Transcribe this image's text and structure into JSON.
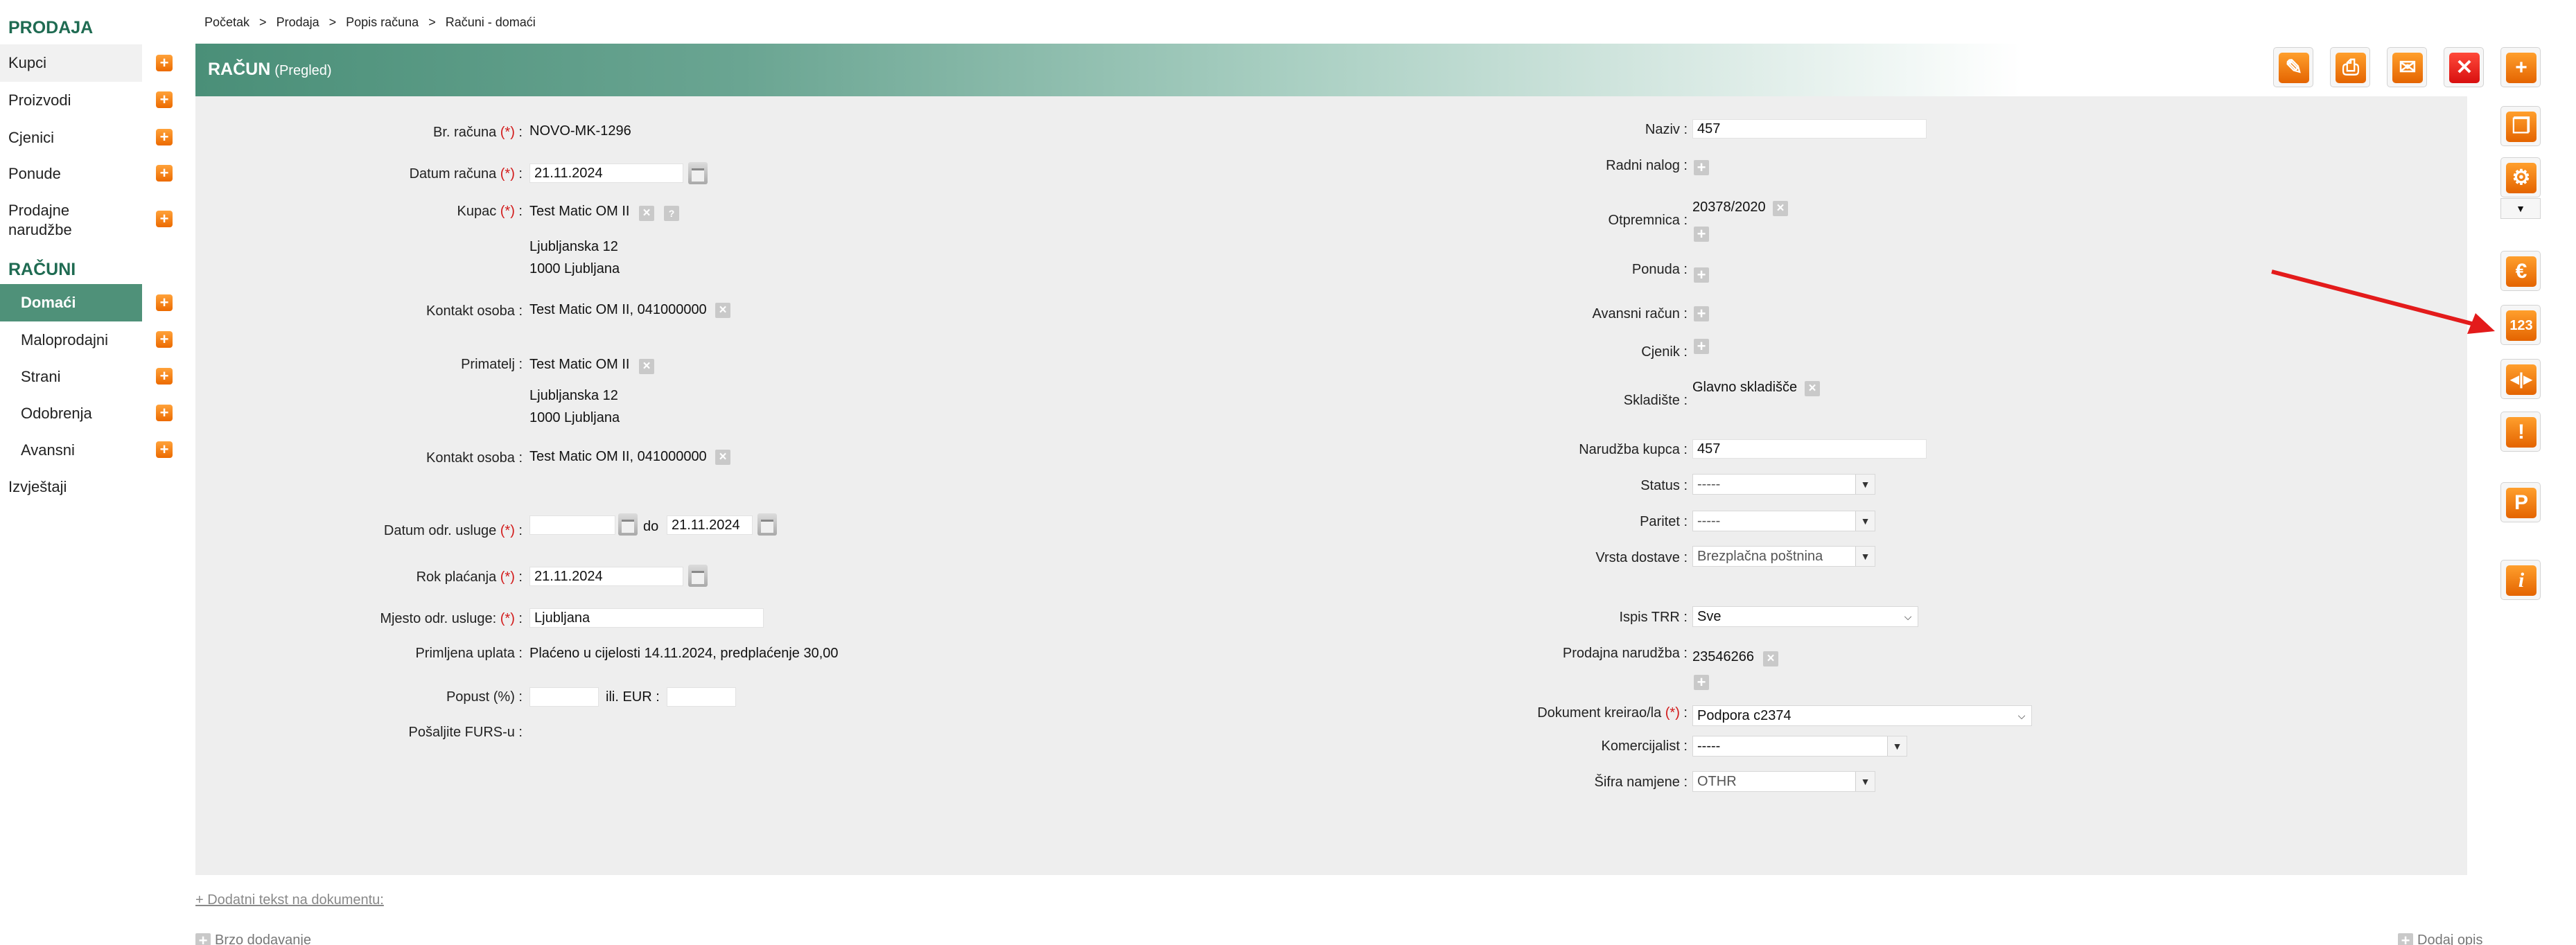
{
  "sidebar": {
    "prodaja_title": "PRODAJA",
    "prodaja_items": [
      {
        "label": "Kupci"
      },
      {
        "label": "Proizvodi"
      },
      {
        "label": "Cjenici"
      },
      {
        "label": "Ponude"
      },
      {
        "label": "Prodajne narudžbe"
      }
    ],
    "racuni_title": "RAČUNI",
    "racuni_items": [
      {
        "label": "Domaći"
      },
      {
        "label": "Maloprodajni"
      },
      {
        "label": "Strani"
      },
      {
        "label": "Odobrenja"
      },
      {
        "label": "Avansni"
      }
    ],
    "izvjestaji": "Izvještaji"
  },
  "breadcrumb": [
    "Početak",
    ">",
    "Prodaja",
    ">",
    "Popis računa",
    ">",
    "Računi - domaći"
  ],
  "header": {
    "title": "RAČUN",
    "subtitle": "(Pregled)"
  },
  "left": {
    "br_racuna_label": "Br. računa",
    "br_racuna": "NOVO-MK-1296",
    "datum_label": "Datum računa",
    "datum": "21.11.2024",
    "kupac_label": "Kupac",
    "kupac": "Test Matic OM II",
    "kupac_addr1": "Ljubljanska 12",
    "kupac_addr2": "1000 Ljubljana",
    "kontakt_label": "Kontakt osoba :",
    "kontakt": "Test Matic OM II, 041000000",
    "primatelj_label": "Primatelj :",
    "primatelj": "Test Matic OM II",
    "primatelj_addr1": "Ljubljanska 12",
    "primatelj_addr2": "1000 Ljubljana",
    "kontakt2_label": "Kontakt osoba :",
    "kontakt2": "Test Matic OM II, 041000000",
    "datum_usluge_label": "Datum odr. usluge",
    "datum_usluge_from": "",
    "do": "do",
    "datum_usluge_to": "21.11.2024",
    "rok_label": "Rok plaćanja",
    "rok": "21.11.2024",
    "mjesto_label": "Mjesto odr. usluge:",
    "mjesto": "Ljubljana",
    "uplata_label": "Primljena uplata :",
    "uplata": "Plaćeno u cijelosti 14.11.2024, predplaćenje 30,00",
    "popust_label": "Popust (%) :",
    "popust": "",
    "ili_eur": "ili. EUR :",
    "eur": "",
    "furs_label": "Pošaljite FURS-u :"
  },
  "right": {
    "naziv_label": "Naziv :",
    "naziv": "457",
    "radni_nalog_label": "Radni nalog :",
    "otpremnica_label": "Otpremnica :",
    "otpremnica": "20378/2020",
    "ponuda_label": "Ponuda :",
    "avansni_label": "Avansni račun :",
    "cjenik_label": "Cjenik :",
    "skladiste_label": "Skladište :",
    "skladiste": "Glavno skladišče",
    "narudzba_kupca_label": "Narudžba kupca :",
    "narudzba_kupca": "457",
    "status_label": "Status :",
    "status": "-----",
    "paritet_label": "Paritet :",
    "paritet": "-----",
    "vrsta_label": "Vrsta dostave :",
    "vrsta": "Brezplačna poštnina",
    "ispis_label": "Ispis TRR :",
    "ispis": "Sve",
    "prodajna_label": "Prodajna narudžba :",
    "prodajna": "23546266",
    "dokument_label": "Dokument kreirao/la",
    "dokument": "Podpora c2374",
    "komercijalist_label": "Komercijalist :",
    "komercijalist": "-----",
    "sifra_label": "Šifra namjene :",
    "sifra": "OTHR"
  },
  "footer": {
    "dodatni": "+ Dodatni tekst na dokumentu:",
    "brzo": "Brzo dodavanje",
    "dodaj_opis": "Dodaj opis"
  },
  "required_mark": "(*)",
  "colors": {
    "accent": "#4f9179",
    "orange": "#f07d10",
    "red": "#e31b1b"
  }
}
